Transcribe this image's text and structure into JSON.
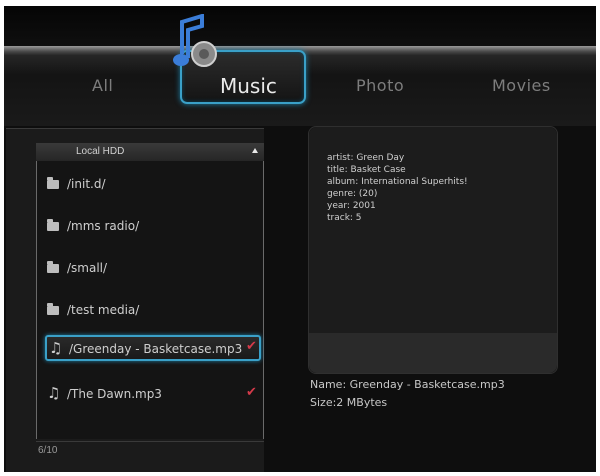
{
  "tabs": {
    "all": "All",
    "music": "Music",
    "photo": "Photo",
    "movies": "Movies"
  },
  "file_panel": {
    "header": "Local HDD",
    "items": [
      {
        "type": "folder",
        "label": "/init.d/",
        "checked": false
      },
      {
        "type": "folder",
        "label": "/mms radio/",
        "checked": false
      },
      {
        "type": "folder",
        "label": "/small/",
        "checked": false
      },
      {
        "type": "folder",
        "label": "/test media/",
        "checked": false
      },
      {
        "type": "audio",
        "label": "/Greenday - Basketcase.mp3",
        "checked": true,
        "selected": true
      },
      {
        "type": "audio",
        "label": "/The Dawn.mp3",
        "checked": true
      }
    ],
    "page_counter": "6/10",
    "check_glyph": "✔",
    "note_glyph": "♫"
  },
  "info": {
    "artist": "artist: Green Day",
    "title": "title: Basket Case",
    "album": "album: International Superhits!",
    "genre": "genre: (20)",
    "year": "year: 2001",
    "track": "track: 5",
    "file_name": "Name: Greenday - Basketcase.mp3",
    "file_size": "Size:2 MBytes"
  },
  "colors": {
    "accent": "#3aa0c8",
    "check": "#d43a4a"
  }
}
